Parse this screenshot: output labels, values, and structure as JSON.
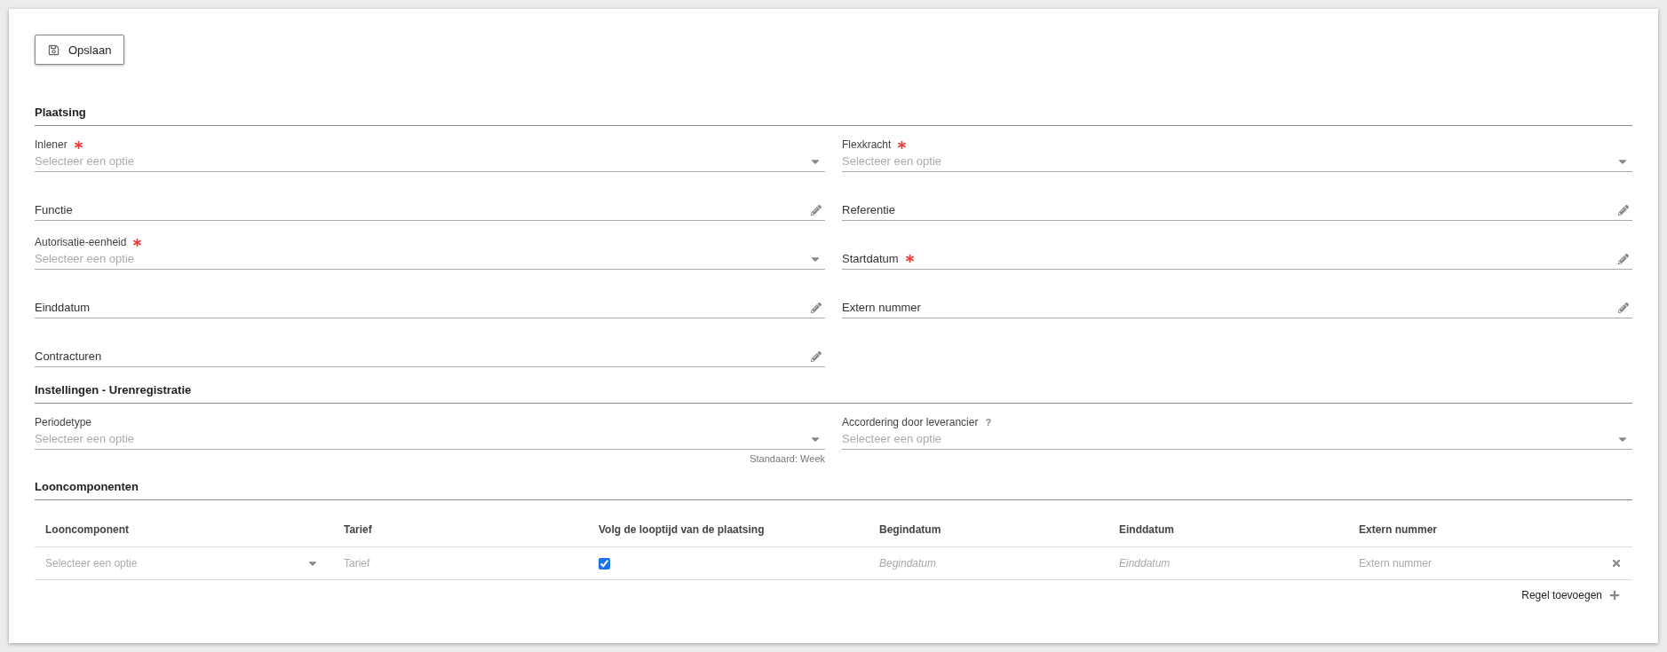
{
  "toolbar": {
    "save_button": "Opslaan"
  },
  "sections": [
    {
      "title": "Plaatsing",
      "fields": [
        {
          "kind": "select",
          "label": "Inlener",
          "required": true,
          "placeholder": "Selecteer een optie"
        },
        {
          "kind": "select",
          "label": "Flexkracht",
          "required": true,
          "placeholder": "Selecteer een optie"
        },
        {
          "kind": "text",
          "label": "Functie",
          "required": false
        },
        {
          "kind": "text",
          "label": "Referentie",
          "required": false
        },
        {
          "kind": "select",
          "label": "Autorisatie-eenheid",
          "required": true,
          "placeholder": "Selecteer een optie"
        },
        {
          "kind": "text",
          "label": "Startdatum",
          "required": true
        },
        {
          "kind": "text",
          "label": "Einddatum",
          "required": false
        },
        {
          "kind": "text",
          "label": "Extern nummer",
          "required": false
        },
        {
          "kind": "text",
          "label": "Contracturen",
          "required": false
        }
      ]
    },
    {
      "title": "Instellingen - Urenregistratie",
      "fields": [
        {
          "kind": "select",
          "label": "Periodetype",
          "required": false,
          "placeholder": "Selecteer een optie",
          "hint": "Standaard: Week"
        },
        {
          "kind": "select",
          "label": "Accordering door leverancier",
          "required": false,
          "help": "?",
          "placeholder": "Selecteer een optie"
        }
      ]
    }
  ],
  "wage_components": {
    "title": "Looncomponenten",
    "columns": [
      "Looncomponent",
      "Tarief",
      "Volg de looptijd van de plaatsing",
      "Begindatum",
      "Einddatum",
      "Extern nummer"
    ],
    "rows": [
      {
        "cells": [
          {
            "kind": "select",
            "placeholder": "Selecteer een optie"
          },
          {
            "kind": "text",
            "placeholder": "Tarief"
          },
          {
            "kind": "checkbox",
            "checked": true
          },
          {
            "kind": "date",
            "placeholder": "Begindatum"
          },
          {
            "kind": "date",
            "placeholder": "Einddatum"
          },
          {
            "kind": "text",
            "placeholder": "Extern nummer"
          }
        ]
      }
    ],
    "add_row": "Regel toevoegen"
  }
}
